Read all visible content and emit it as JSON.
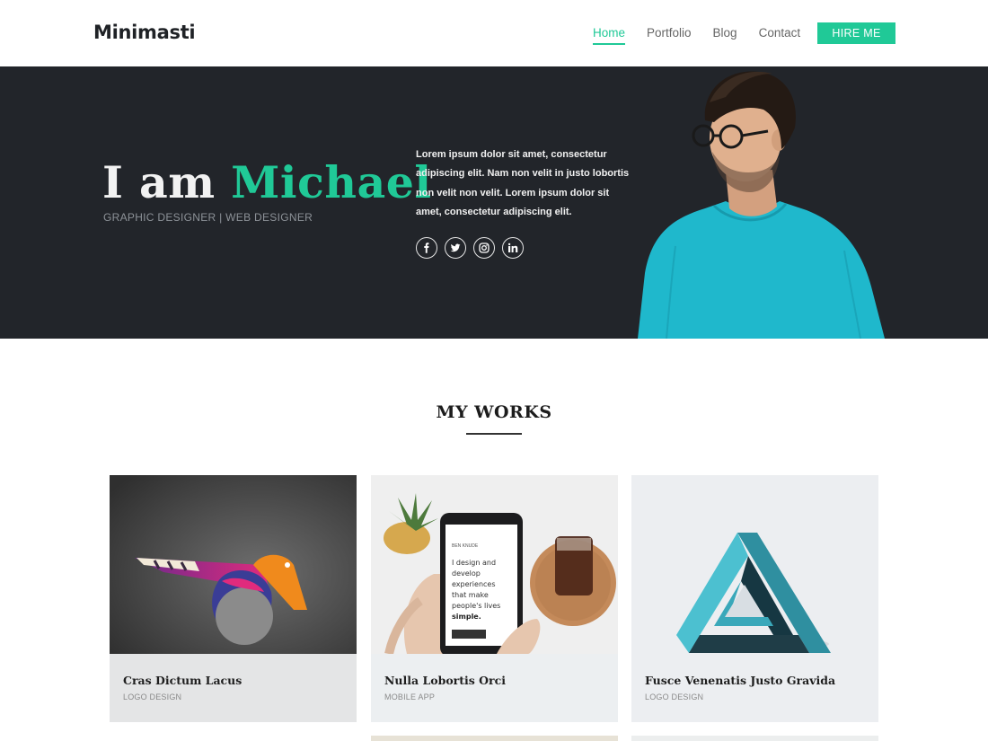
{
  "header": {
    "logo": "Minimasti",
    "nav": [
      {
        "label": "Home",
        "active": true
      },
      {
        "label": "Portfolio",
        "active": false
      },
      {
        "label": "Blog",
        "active": false
      },
      {
        "label": "Contact",
        "active": false
      }
    ],
    "cta": "HIRE ME"
  },
  "hero": {
    "title_prefix": "I am",
    "title_name": "Michael",
    "subtitle": "GRAPHIC DESIGNER | WEB DESIGNER",
    "body": "Lorem ipsum dolor sit amet, consectetur adipiscing elit. Nam non velit in justo lobortis non velit non velit. Lorem ipsum dolor sit amet, consectetur adipiscing elit.",
    "socials": [
      "facebook-icon",
      "twitter-icon",
      "instagram-icon",
      "linkedin-icon"
    ]
  },
  "works": {
    "title": "MY WORKS",
    "items": [
      {
        "title": "Cras Dictum Lacus",
        "category": "LOGO DESIGN"
      },
      {
        "title": "Nulla Lobortis Orci",
        "category": "MOBILE APP"
      },
      {
        "title": "Fusce Venenatis Justo Gravida",
        "category": "LOGO DESIGN"
      }
    ],
    "phone_text": "I design and develop experiences that make people's lives",
    "phone_text_bold": "simple."
  },
  "colors": {
    "accent": "#20c997",
    "hero_bg": "#22252a",
    "shirt": "#1fb8cc"
  }
}
